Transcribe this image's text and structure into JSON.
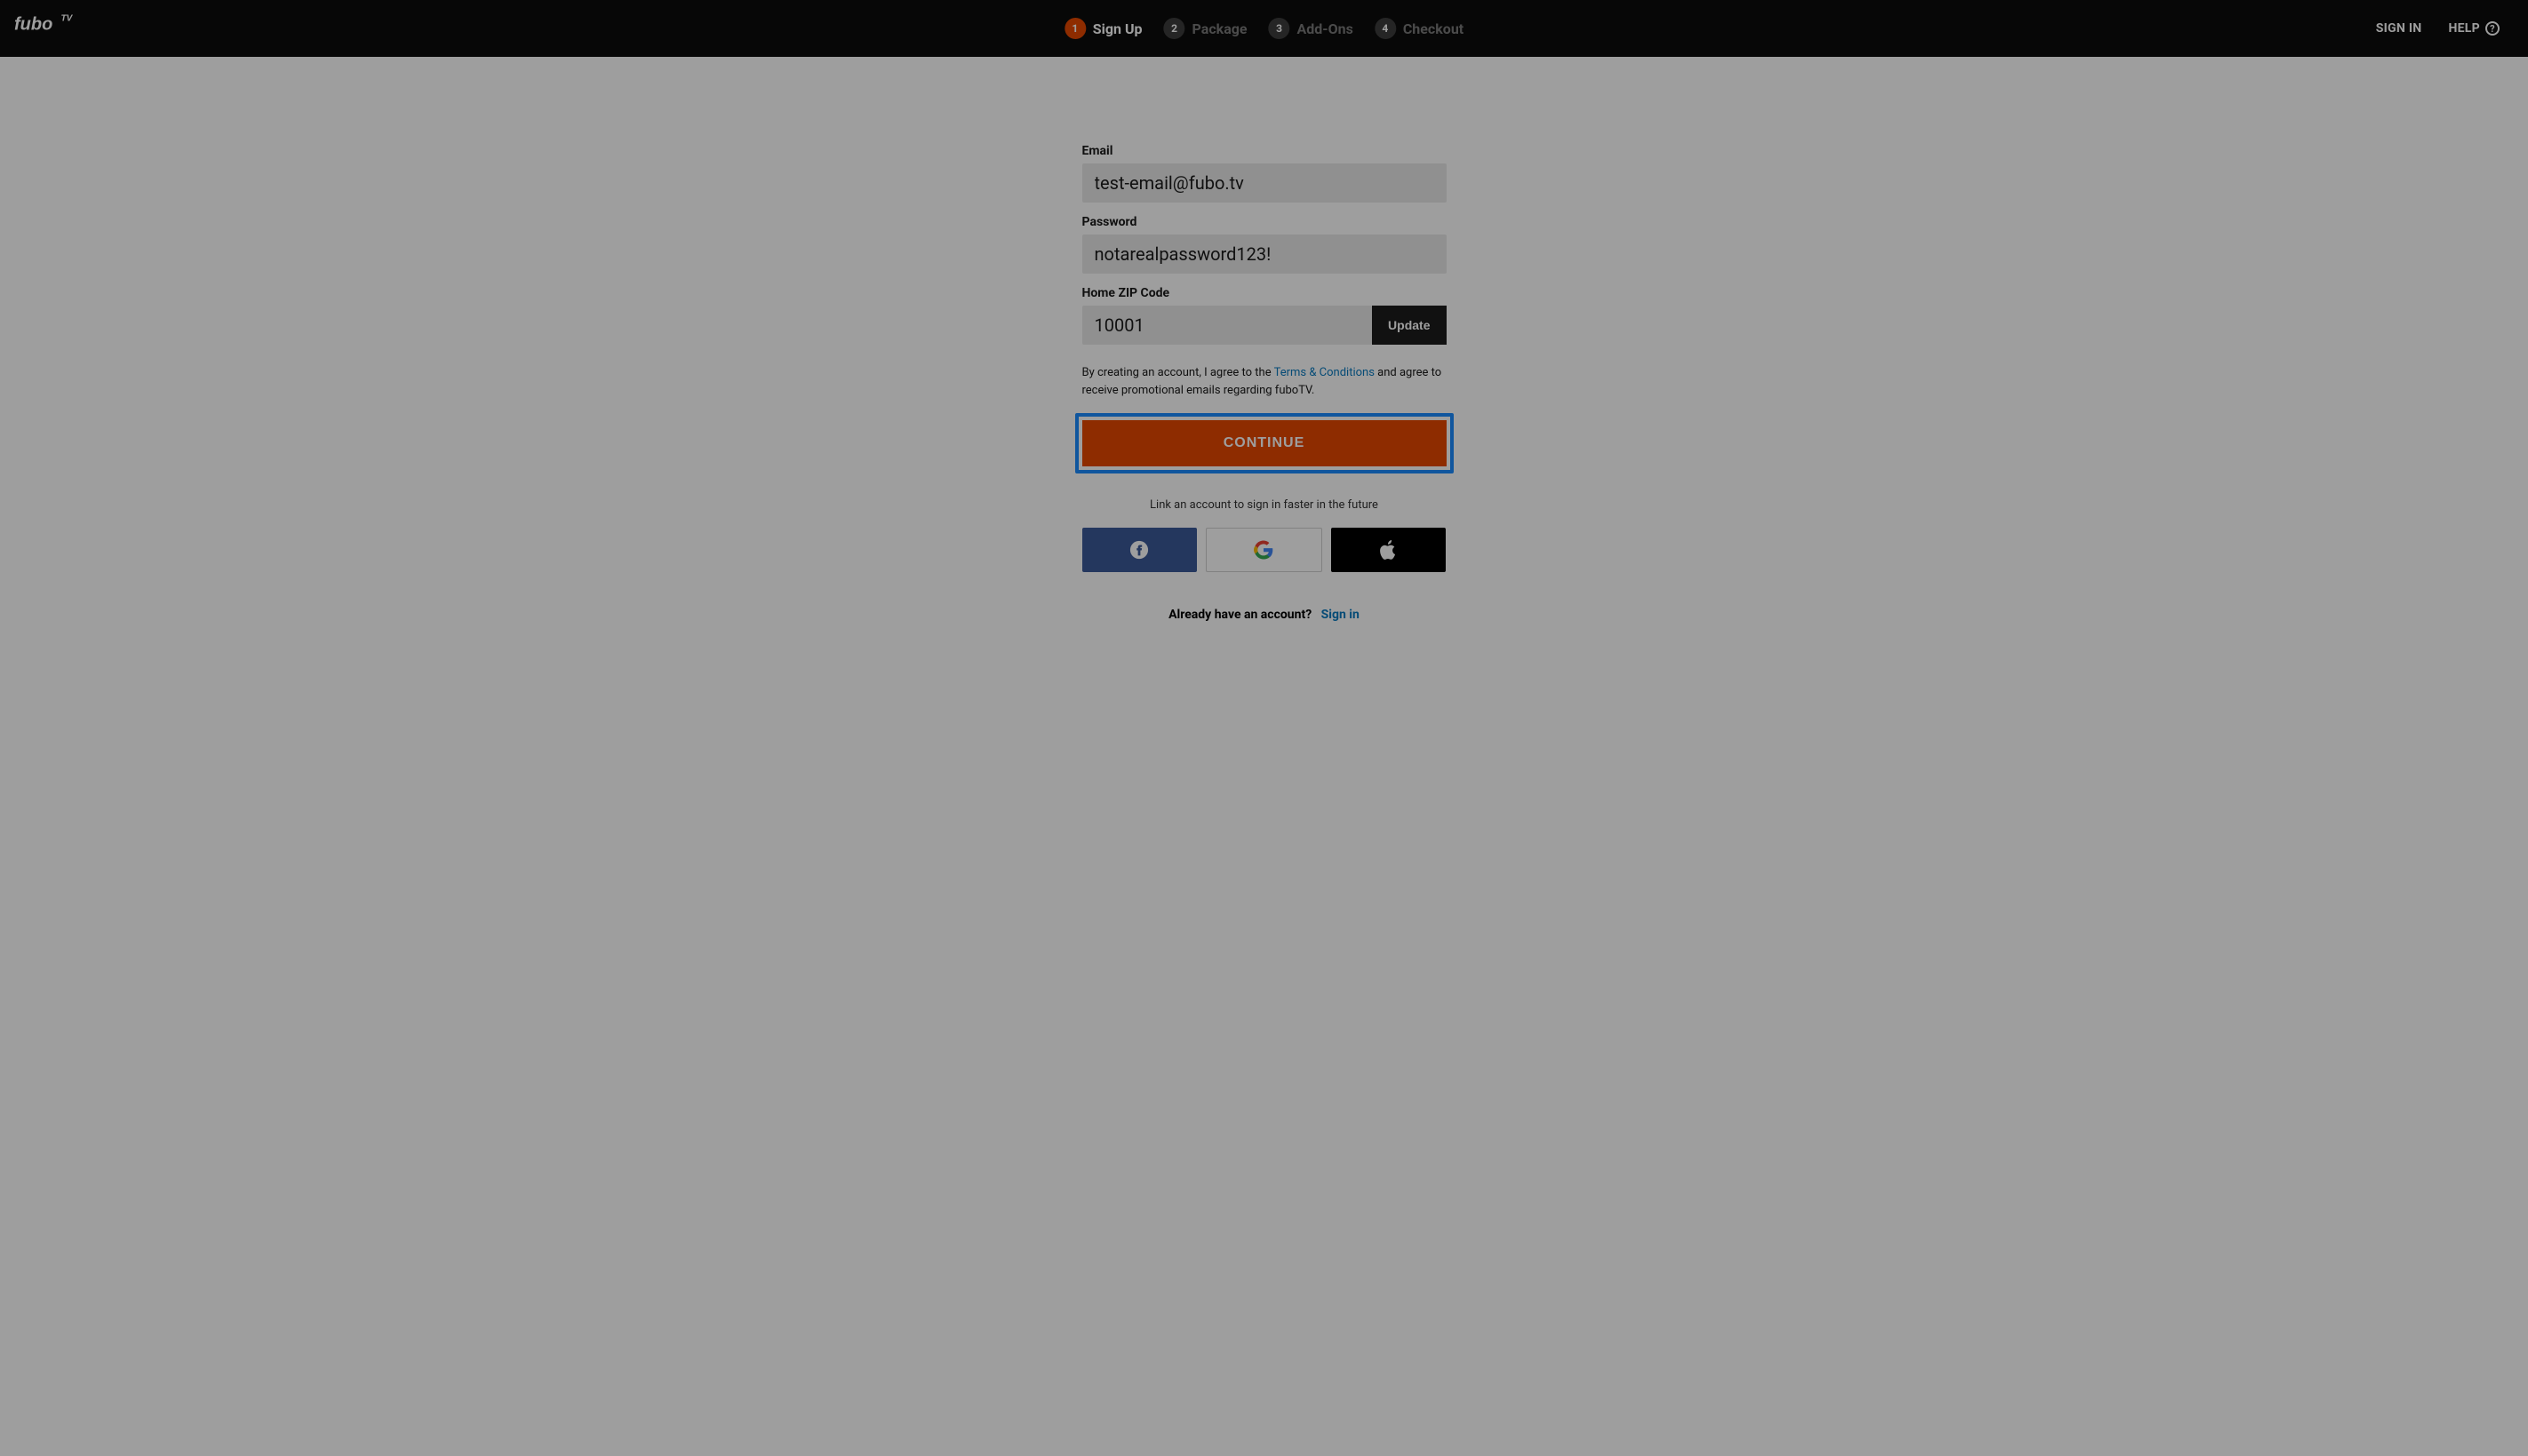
{
  "header": {
    "steps": [
      {
        "num": "1",
        "label": "Sign Up",
        "active": true
      },
      {
        "num": "2",
        "label": "Package",
        "active": false
      },
      {
        "num": "3",
        "label": "Add-Ons",
        "active": false
      },
      {
        "num": "4",
        "label": "Checkout",
        "active": false
      }
    ],
    "sign_in": "SIGN IN",
    "help": "HELP"
  },
  "form": {
    "email_label": "Email",
    "email_value": "test-email@fubo.tv",
    "password_label": "Password",
    "password_value": "notarealpassword123!",
    "zip_label": "Home ZIP Code",
    "zip_value": "10001",
    "update_label": "Update",
    "terms_pre": "By creating an account, I agree to the ",
    "terms_link": "Terms & Conditions",
    "terms_post": " and agree to receive promotional emails regarding fuboTV.",
    "continue_label": "CONTINUE",
    "link_hint": "Link an account to sign in faster in the future",
    "already_text": "Already have an account?",
    "already_link": "Sign in"
  }
}
